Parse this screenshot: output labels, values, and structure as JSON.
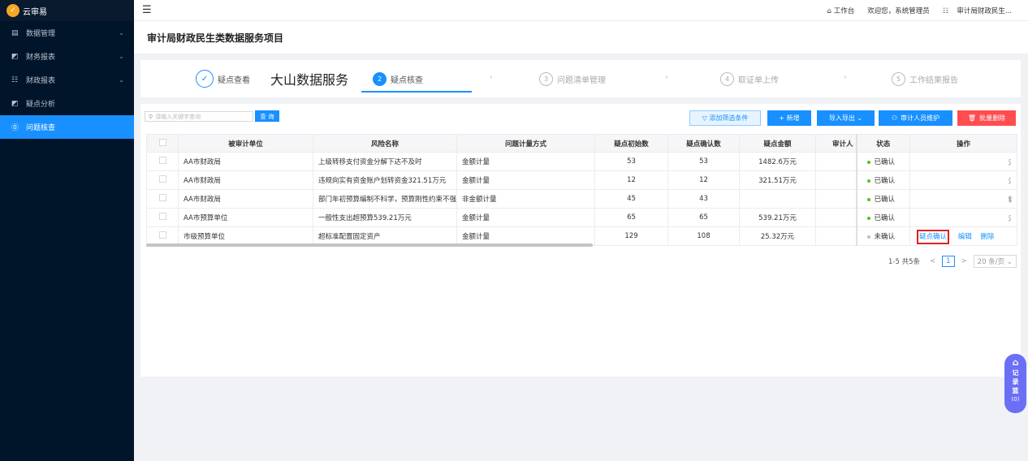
{
  "app": {
    "name": "云审易"
  },
  "sidebar": {
    "items": [
      {
        "label": "数据管理",
        "icon": "database-icon",
        "chev": "⌄"
      },
      {
        "label": "财务报表",
        "icon": "chart-icon",
        "chev": "⌄"
      },
      {
        "label": "财政报表",
        "icon": "list-icon",
        "chev": "⌄"
      },
      {
        "label": "疑点分析",
        "icon": "analysis-icon",
        "chev": ""
      },
      {
        "label": "问题核查",
        "icon": "question-icon",
        "chev": ""
      }
    ]
  },
  "topbar": {
    "workbench": "工作台",
    "welcome": "欢迎您，系统管理员",
    "org": "审计局财政民生..."
  },
  "page": {
    "title": "审计局财政民生类数据服务项目"
  },
  "steps": [
    {
      "num": "✓",
      "label": "疑点查看"
    },
    {
      "num": "",
      "label": "大山数据服务"
    },
    {
      "num": "2",
      "label": "疑点核查"
    },
    {
      "num": "3",
      "label": "问题清单管理"
    },
    {
      "num": "4",
      "label": "取证单上传"
    },
    {
      "num": "5",
      "label": "工作结果报告"
    }
  ],
  "toolbar": {
    "search_placeholder": "请输入关键字查询",
    "query": "查 询",
    "filter": "▽ 添加筛选条件",
    "add": "+ 新增",
    "import_export": "导入导出 ⌄",
    "auditor": "审计人员维护",
    "batch_delete": "批量删除"
  },
  "table": {
    "columns": [
      "被审计单位",
      "风险名称",
      "问题计量方式",
      "疑点初始数",
      "疑点确认数",
      "疑点金额",
      "审计人",
      "状态",
      "操作"
    ],
    "rows": [
      {
        "unit": "AA市财政局",
        "risk": "上级转移支付资金分解下达不及时",
        "method": "金额计量",
        "init": "53",
        "confirm": "53",
        "amount": "1482.6万元",
        "auditor": "",
        "status": "已确认",
        "status_color": "#52c41a",
        "edge": "氵"
      },
      {
        "unit": "AA市财政局",
        "risk": "违规向实有资金账户划转资金321.51万元",
        "method": "金额计量",
        "init": "12",
        "confirm": "12",
        "amount": "321.51万元",
        "auditor": "",
        "status": "已确认",
        "status_color": "#52c41a",
        "edge": "氵"
      },
      {
        "unit": "AA市财政局",
        "risk": "部门年初预算编制不科学，预算刚性约束不强",
        "method": "非金额计量",
        "init": "45",
        "confirm": "43",
        "amount": "",
        "auditor": "",
        "status": "已确认",
        "status_color": "#52c41a",
        "edge": "钅"
      },
      {
        "unit": "AA市预算单位",
        "risk": "一般性支出超预算539.21万元",
        "method": "金额计量",
        "init": "65",
        "confirm": "65",
        "amount": "539.21万元",
        "auditor": "",
        "status": "已确认",
        "status_color": "#52c41a",
        "edge": "氵"
      },
      {
        "unit": "市级预算单位",
        "risk": "超标准配置固定资产",
        "method": "金额计量",
        "init": "129",
        "confirm": "108",
        "amount": "25.32万元",
        "auditor": "",
        "status": "未确认",
        "status_color": "#bfbfbf",
        "edge": "",
        "ops": [
          "疑点确认",
          "编辑",
          "删除"
        ]
      }
    ]
  },
  "pager": {
    "total": "1-5 共5条",
    "prev": "<",
    "page": "1",
    "next": ">",
    "size": "20 条/页 ⌄"
  },
  "float": {
    "label": "记录篮",
    "count": "(0)"
  }
}
